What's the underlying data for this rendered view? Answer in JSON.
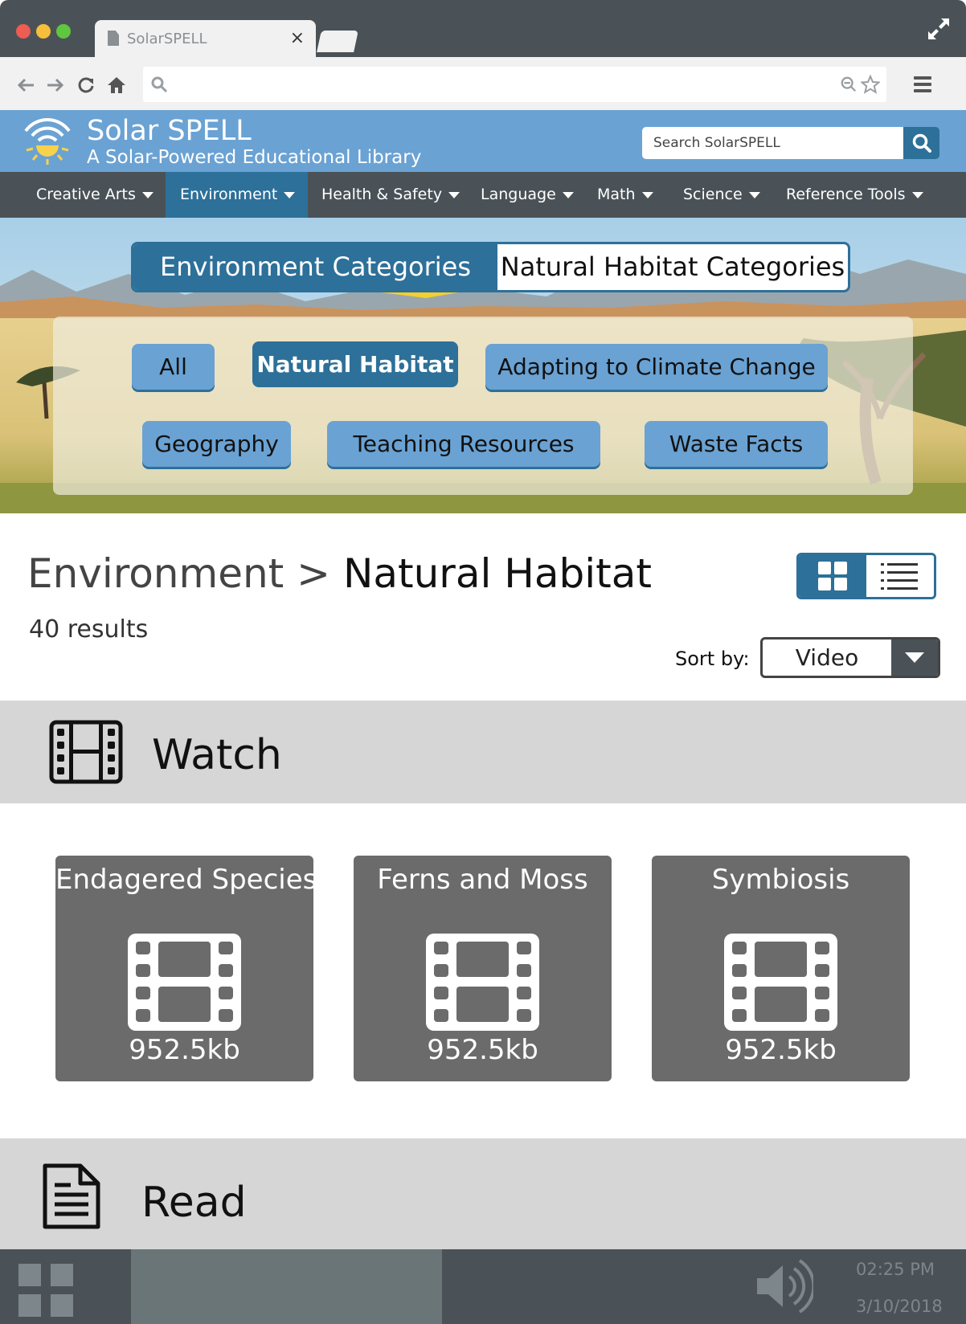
{
  "browser": {
    "tab_title": "SolarSPELL",
    "tab_close": "×"
  },
  "site": {
    "title": "Solar SPELL",
    "subtitle": "A Solar-Powered Educational Library",
    "search_placeholder": "Search SolarSPELL"
  },
  "nav": {
    "items": [
      {
        "label": "Creative Arts"
      },
      {
        "label": "Environment"
      },
      {
        "label": "Health & Safety"
      },
      {
        "label": "Language"
      },
      {
        "label": "Math"
      },
      {
        "label": "Science"
      },
      {
        "label": "Reference Tools"
      }
    ],
    "active": "Environment"
  },
  "categories": {
    "tabs": [
      "Environment Categories",
      "Natural Habitat Categories"
    ],
    "active_tab": "Environment Categories",
    "pills": [
      "All",
      "Natural Habitat",
      "Adapting to Climate Change",
      "Geography",
      "Teaching Resources",
      "Waste Facts"
    ],
    "selected_pill": "Natural Habitat"
  },
  "content": {
    "breadcrumb_parent": "Environment",
    "breadcrumb_sep": " > ",
    "breadcrumb_current": "Natural Habitat",
    "results": "40 results",
    "sort_label": "Sort by:",
    "sort_value": "Video",
    "view_mode": "grid"
  },
  "sections": {
    "watch": {
      "title": "Watch",
      "icon": "film-icon",
      "cards": [
        {
          "title": "Endagered Species",
          "size": "952.5kb"
        },
        {
          "title": "Ferns and Moss",
          "size": "952.5kb"
        },
        {
          "title": "Symbiosis",
          "size": "952.5kb"
        }
      ]
    },
    "read": {
      "title": "Read",
      "icon": "document-icon"
    }
  },
  "taskbar": {
    "time": "02:25 PM",
    "date": "3/10/2018"
  },
  "colors": {
    "chrome": "#4a5257",
    "header_blue": "#6aa2d3",
    "accent": "#2d7099",
    "card": "#6b6b6b",
    "band": "#d6d6d6"
  }
}
